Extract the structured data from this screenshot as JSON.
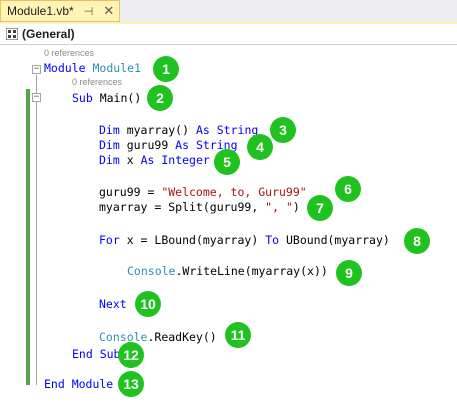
{
  "tab": {
    "title": "Module1.vb*",
    "pin": "⊣",
    "close": "✕"
  },
  "navbar": {
    "label": "(General)",
    "icon": "class-view-icon"
  },
  "references": {
    "module": "0 references",
    "sub": "0 references"
  },
  "code": {
    "module_kw": "Module",
    "module_name": "Module1",
    "sub_kw": "Sub",
    "sub_name": " Main()",
    "dim1": {
      "kw": "Dim",
      "mid": " myarray() ",
      "as": "As",
      "type": "String"
    },
    "dim2": {
      "kw": "Dim",
      "mid": " guru99 ",
      "as": "As",
      "type": "String"
    },
    "dim3": {
      "kw": "Dim",
      "mid": " x ",
      "as": "As",
      "type": "Integer"
    },
    "assign1": {
      "left": "guru99 = ",
      "str": "\"Welcome, to, Guru99\""
    },
    "assign2": {
      "left": "myarray = Split(guru99, ",
      "str": "\", \"",
      "right": ")"
    },
    "for": {
      "kw": "For",
      "mid": " x = LBound(myarray) ",
      "to": "To",
      "end": " UBound(myarray)"
    },
    "write": {
      "cls": "Console",
      "rest": ".WriteLine(myarray(x))"
    },
    "next": "Next",
    "read": {
      "cls": "Console",
      "rest": ".ReadKey()"
    },
    "endsub": "End Sub",
    "endmodule": "End Module"
  },
  "badges": [
    "1",
    "2",
    "3",
    "4",
    "5",
    "6",
    "7",
    "8",
    "9",
    "10",
    "11",
    "12",
    "13"
  ],
  "colors": {
    "keyword": "#0000ff",
    "type": "#2b91af",
    "string": "#a31515",
    "badge": "#1fc21f",
    "change_bar": "#57a64a"
  }
}
